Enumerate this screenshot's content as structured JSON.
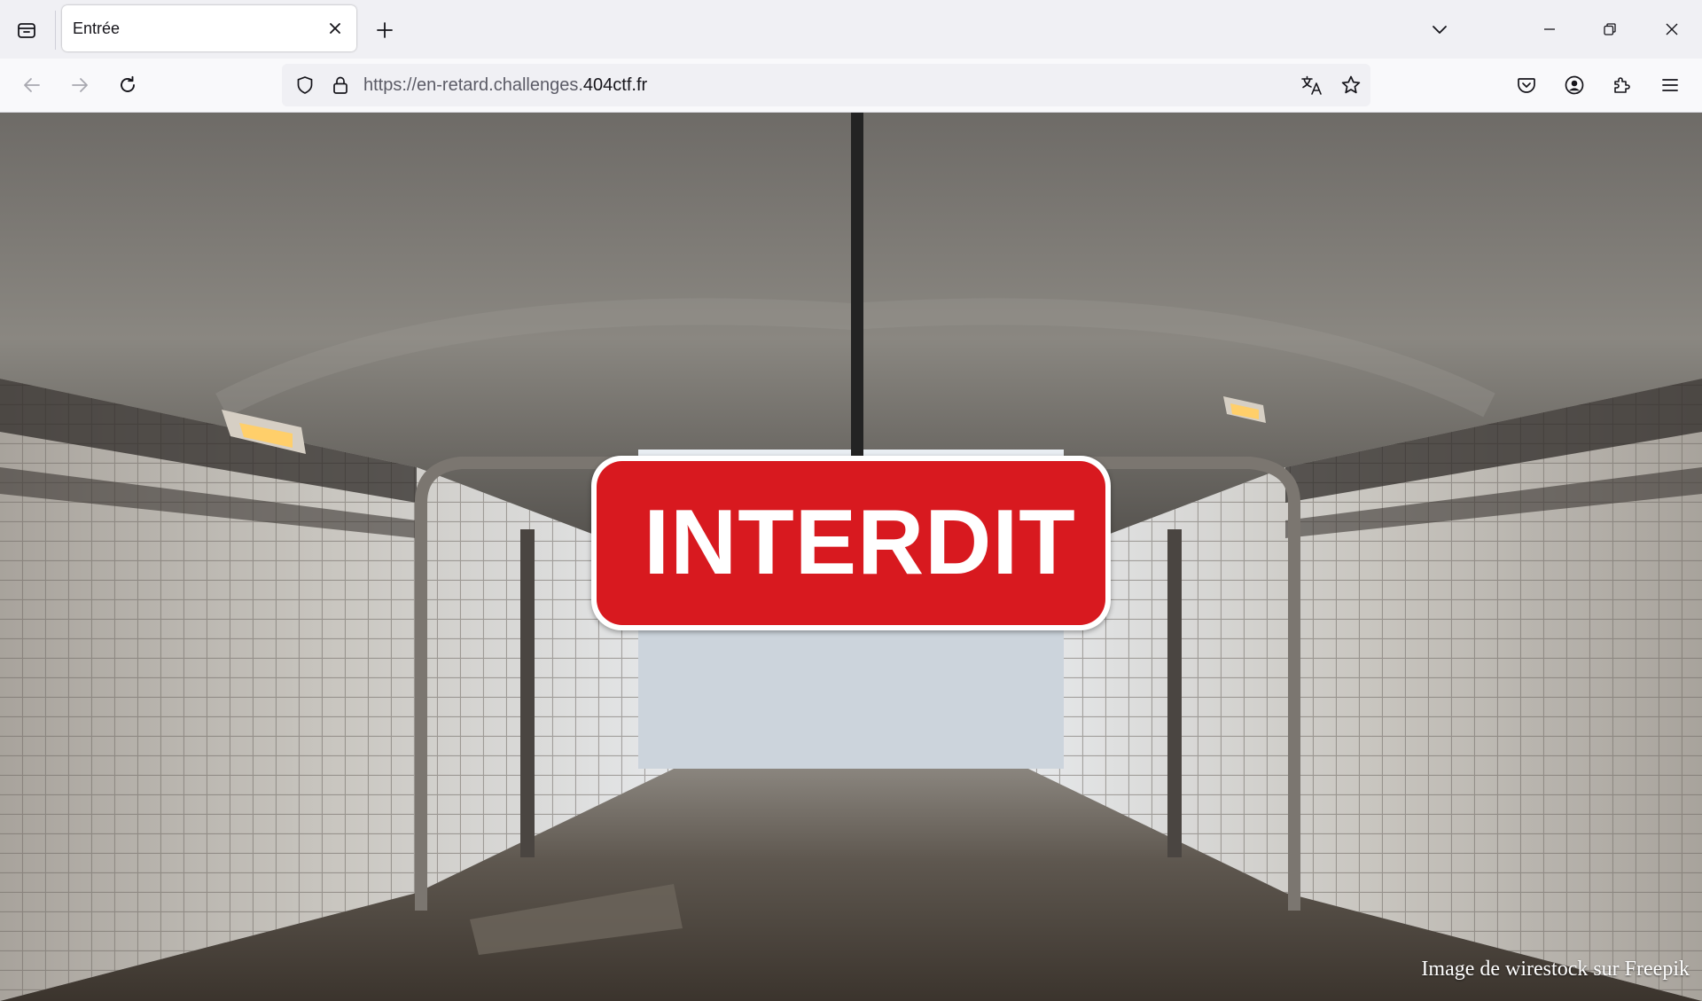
{
  "browser": {
    "tabs": [
      {
        "title": "Entrée",
        "active": true
      }
    ],
    "url": {
      "prefix": "https://en-retard.challenges.",
      "domain": "404ctf.fr"
    },
    "icons": {
      "tab_list": "tab-list-icon",
      "close_tab": "close-icon",
      "new_tab": "plus-icon",
      "tab_overflow": "chevron-down-icon",
      "minimize": "minimize-icon",
      "restore": "restore-icon",
      "close_window": "close-icon",
      "back": "arrow-left-icon",
      "forward": "arrow-right-icon",
      "reload": "reload-icon",
      "tracking_protection": "shield-icon",
      "site_security": "lock-icon",
      "translate": "translate-icon",
      "bookmark": "star-icon",
      "pocket": "pocket-icon",
      "account": "account-icon",
      "extensions": "puzzle-icon",
      "menu": "hamburger-icon"
    }
  },
  "page": {
    "sign_text": "INTERDIT",
    "credit": "Image de wirestock sur Freepik",
    "colors": {
      "sign_red": "#d8191f",
      "sign_border": "#ffffff"
    }
  }
}
